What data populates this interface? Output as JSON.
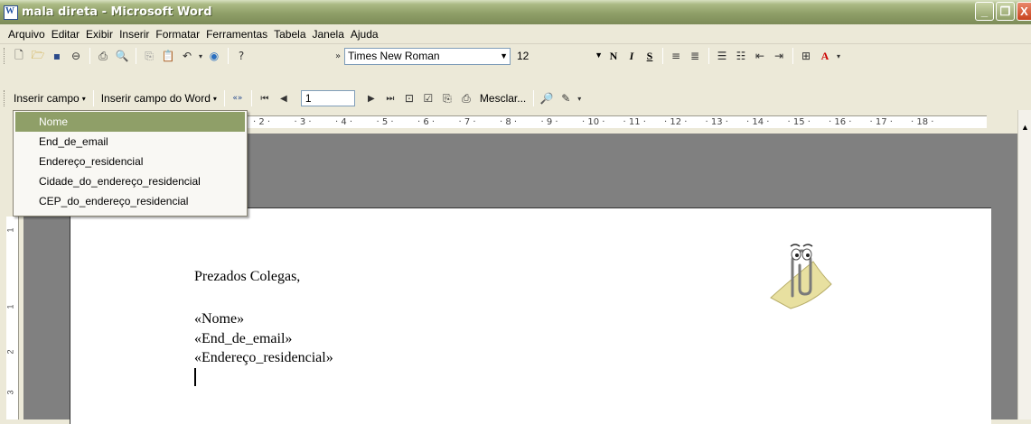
{
  "window": {
    "title": "mala direta - Microsoft Word",
    "minimize": "_",
    "restore": "❐",
    "close": "X"
  },
  "menu": [
    "Arquivo",
    "Editar",
    "Exibir",
    "Inserir",
    "Formatar",
    "Ferramentas",
    "Tabela",
    "Janela",
    "Ajuda"
  ],
  "toolbar_standard": {
    "font_name": "Times New Roman",
    "font_size": "12",
    "bold": "N",
    "italic": "I",
    "underline": "S"
  },
  "toolbar_mailmerge": {
    "insert_field": "Inserir campo",
    "insert_word_field": "Inserir campo do Word",
    "record_number": "1",
    "merge_button": "Mesclar..."
  },
  "dropdown": {
    "items": [
      "Nome",
      "End_de_email",
      "Endereço_residencial",
      "Cidade_do_endereço_residencial",
      "CEP_do_endereço_residencial"
    ],
    "selected_index": 0
  },
  "ruler": {
    "marks": [
      "2",
      "3",
      "4",
      "5",
      "6",
      "7",
      "8",
      "9",
      "10",
      "11",
      "12",
      "13",
      "14",
      "15",
      "16",
      "17",
      "18"
    ],
    "vertical_marks": [
      "1",
      "1",
      "2",
      "3"
    ]
  },
  "document": {
    "greeting": "Prezados Colegas,",
    "fields": [
      "«Nome»",
      "«End_de_email»",
      "«Endereço_residencial»"
    ]
  },
  "colors": {
    "titlebar": "#8f9f68",
    "selection": "#8f9f68",
    "workspace": "#808080"
  }
}
